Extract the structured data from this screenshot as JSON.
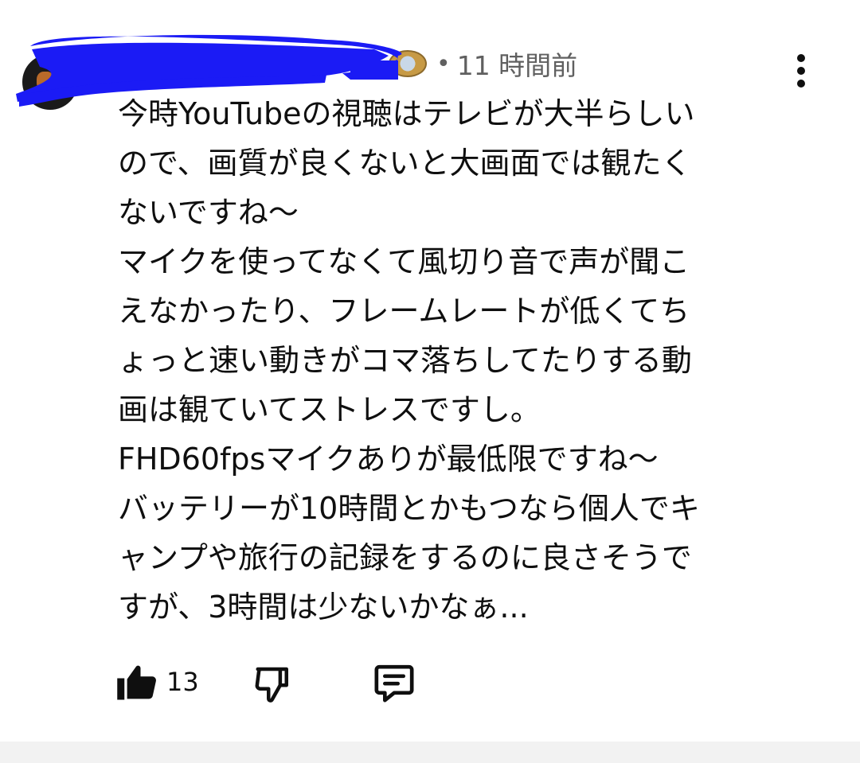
{
  "comment": {
    "author_name": "@・・・・・・・・・",
    "dot_separator": "•",
    "timestamp": "11 時間前",
    "body_lines": [
      "今時YouTubeの視聴はテレビが大半らしい",
      "ので、画質が良くないと大画面では観たく",
      "ないですね〜",
      "マイクを使ってなくて風切り音で声が聞こ",
      "えなかったり、フレームレートが低くてち",
      "ょっと速い動きがコマ落ちしてたりする動",
      "画は観ていてストレスですし。",
      "FHD60fpsマイクありが最低限ですね〜",
      "バッテリーが10時間とかもつなら個人でキ",
      "ャンプや旅行の記録をするのに良さそうで",
      "すが、3時間は少ないかなぁ..."
    ],
    "like_count": "13"
  },
  "icons": {
    "like": "thumbs-up-icon",
    "dislike": "thumbs-down-icon",
    "reply": "comment-reply-icon",
    "menu": "more-vertical-icon"
  },
  "colors": {
    "redaction": "#1b1bf5",
    "text": "#0f0f0f",
    "meta": "#606060"
  }
}
